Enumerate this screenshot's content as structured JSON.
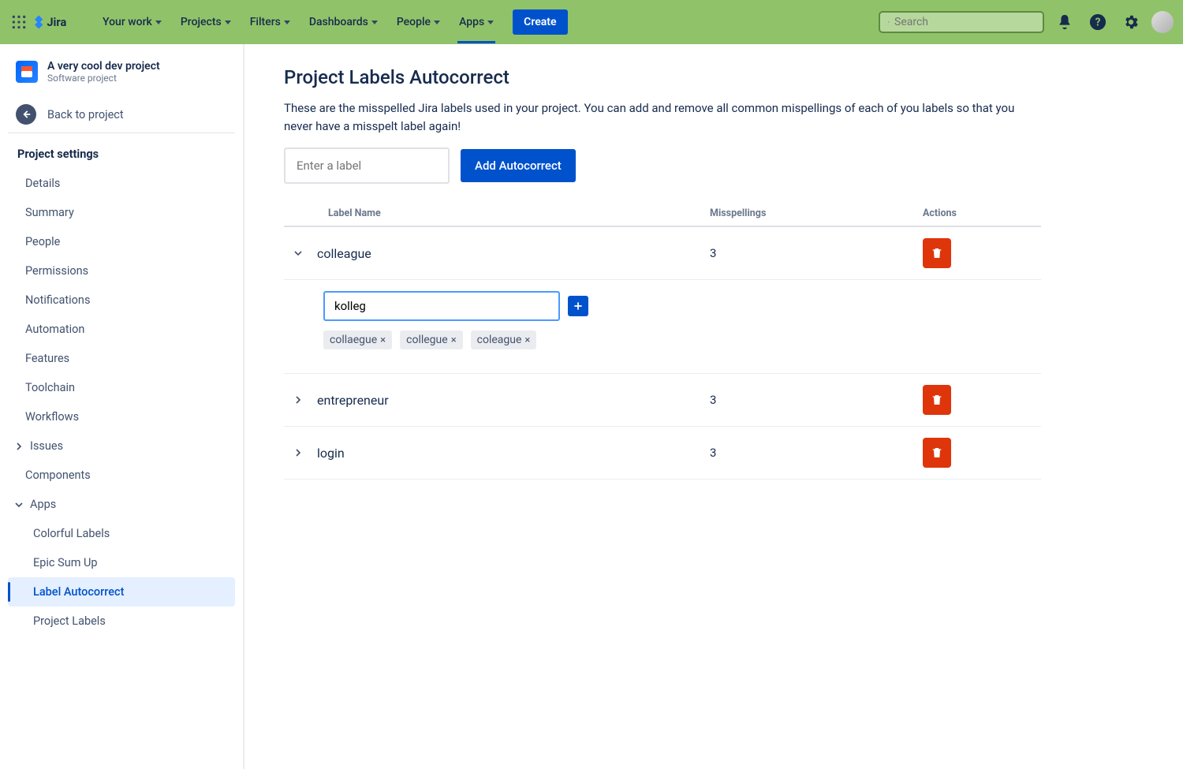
{
  "topnav": {
    "items": [
      "Your work",
      "Projects",
      "Filters",
      "Dashboards",
      "People",
      "Apps"
    ],
    "create_label": "Create",
    "search_placeholder": "Search"
  },
  "sidebar": {
    "project_name": "A very cool dev project",
    "project_type": "Software project",
    "back_label": "Back to project",
    "settings_heading": "Project settings",
    "items": [
      "Details",
      "Summary",
      "People",
      "Permissions",
      "Notifications",
      "Automation",
      "Features",
      "Toolchain",
      "Workflows"
    ],
    "issues_label": "Issues",
    "components_label": "Components",
    "apps_label": "Apps",
    "apps_children": [
      "Colorful Labels",
      "Epic Sum Up",
      "Label Autocorrect",
      "Project Labels"
    ],
    "apps_selected_index": 2
  },
  "page": {
    "title": "Project Labels Autocorrect",
    "description": "These are the misspelled Jira labels used in your project. You can add and remove all common mispellings of each of you labels so that you never have a misspelt label again!",
    "label_input_placeholder": "Enter a label",
    "add_button": "Add Autocorrect",
    "columns": {
      "name": "Label Name",
      "misspellings": "Misspellings",
      "actions": "Actions"
    },
    "rows": [
      {
        "label": "colleague",
        "count": "3",
        "expanded": true,
        "input_value": "kolleg",
        "tags": [
          "collaegue",
          "collegue",
          "coleague"
        ]
      },
      {
        "label": "entrepreneur",
        "count": "3",
        "expanded": false
      },
      {
        "label": "login",
        "count": "3",
        "expanded": false
      }
    ]
  }
}
